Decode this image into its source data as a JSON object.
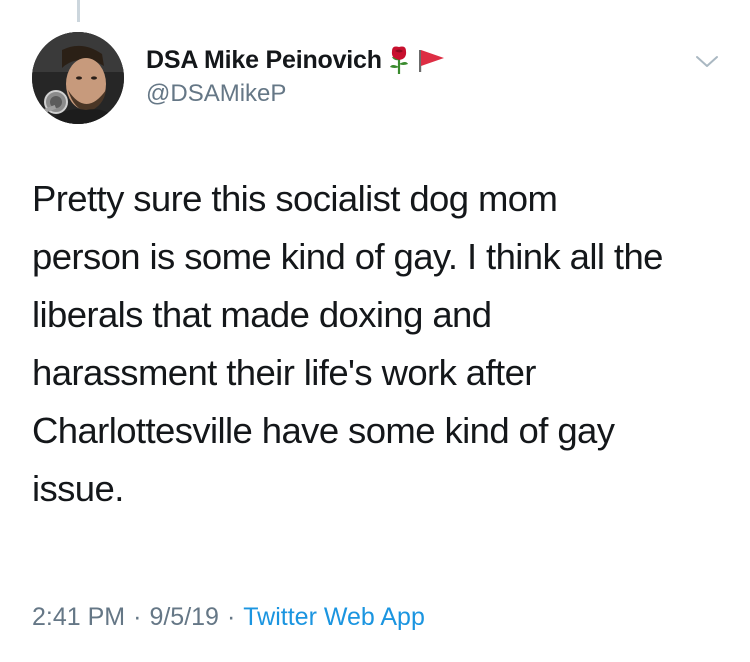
{
  "tweet": {
    "author": {
      "display_name": "DSA Mike Peinovich",
      "handle": "@DSAMikeP",
      "name_emojis": [
        "rose-emoji",
        "red-flag-emoji"
      ]
    },
    "text": "Pretty sure this socialist dog mom\nperson is some kind of gay. I think all the\nliberals that made doxing and\nharassment their life's work after\nCharlottesville have some kind of gay\nissue.",
    "time": "2:41 PM",
    "date": "9/5/19",
    "source": "Twitter Web App",
    "separator": "·"
  },
  "icons": {
    "more_menu": "chevron-down-icon"
  },
  "colors": {
    "text_primary": "#14171a",
    "text_secondary": "#657786",
    "link": "#1b95e0",
    "thread_line": "#ccd6dd",
    "chevron": "#aab8c2"
  }
}
